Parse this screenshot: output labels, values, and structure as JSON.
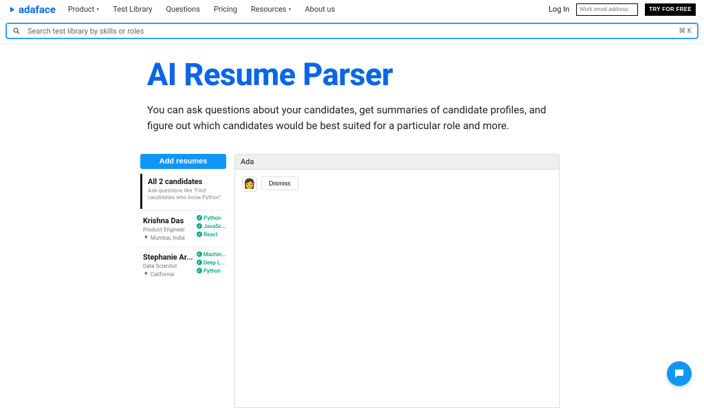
{
  "nav": {
    "brand": "adaface",
    "items": [
      "Product",
      "Test Library",
      "Questions",
      "Pricing",
      "Resources",
      "About us"
    ],
    "login": "Log In",
    "email_placeholder": "Work email address",
    "cta": "TRY FOR FREE"
  },
  "search": {
    "placeholder": "Search test library by skills or roles",
    "kbd": "⌘ K"
  },
  "hero": {
    "title": "AI Resume Parser",
    "desc": "You can ask questions about your candidates, get summaries of candidate profiles, and figure out which candidates would be best suited for a particular role and more."
  },
  "sidebar": {
    "add_button": "Add resumes",
    "all_title": "All 2 candidates",
    "all_sub": "Ask questions like \"Find candidates who know Python\"",
    "candidates": [
      {
        "name": "Krishna Das",
        "role": "Product Engineer",
        "location": "Mumbai, India",
        "skills": [
          "Python",
          "JavaSc...",
          "React"
        ]
      },
      {
        "name": "Stephanie Ar...",
        "role": "Data Scientist",
        "location": "California",
        "skills": [
          "Machin...",
          "Deep L...",
          "Python"
        ]
      }
    ]
  },
  "chat": {
    "tab": "Ada",
    "dismiss": "Dismiss"
  }
}
